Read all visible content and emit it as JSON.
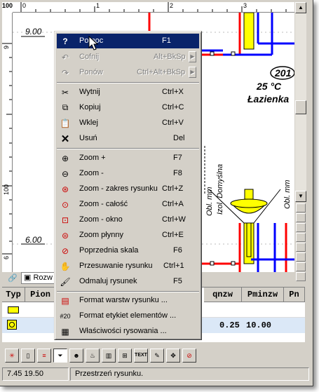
{
  "rulers": {
    "corner": "100",
    "h_ticks": [
      "0",
      "1",
      "2",
      "3"
    ],
    "v_ticks": [
      "9",
      "100",
      "6"
    ]
  },
  "drawing": {
    "level_top": "9.00",
    "level_bottom": "6.00",
    "room_number": "201",
    "room_temp": "25 °C",
    "room_name": "Łazienka",
    "label_izol": "Izol. Domyślna",
    "label_obl_1": "Obl. mm",
    "label_obl_2": "Obl. mm",
    "pipe_red": "#ff0000",
    "pipe_blue": "#0000ff",
    "fixture_yellow": "#ffff00"
  },
  "sheet_tab": {
    "label": "Rozw"
  },
  "table": {
    "headers": [
      "Typ",
      "Pion",
      "qnzw",
      "Pminzw",
      "Pn"
    ],
    "row2": {
      "qnzw": "0.25",
      "pminzw": "10.00"
    },
    "icons": [
      "radiator-type-icon",
      "valve-type-icon"
    ]
  },
  "context_menu": {
    "items": [
      {
        "label": "Pomoc",
        "shortcut": "F1",
        "icon": "help-icon",
        "state": "selected"
      },
      {
        "label": "Cofnij",
        "shortcut": "Alt+BkSp",
        "icon": "undo-icon",
        "state": "disabled",
        "submenu": true
      },
      {
        "label": "Ponów",
        "shortcut": "Ctrl+Alt+BkSp",
        "icon": "redo-icon",
        "state": "disabled",
        "submenu": true
      },
      {
        "label": "Wytnij",
        "shortcut": "Ctrl+X",
        "icon": "cut-icon"
      },
      {
        "label": "Kopiuj",
        "shortcut": "Ctrl+C",
        "icon": "copy-icon"
      },
      {
        "label": "Wklej",
        "shortcut": "Ctrl+V",
        "icon": "paste-icon"
      },
      {
        "label": "Usuń",
        "shortcut": "Del",
        "icon": "delete-icon"
      },
      {
        "label": "Zoom +",
        "shortcut": "F7",
        "icon": "zoom-in-icon"
      },
      {
        "label": "Zoom -",
        "shortcut": "F8",
        "icon": "zoom-out-icon"
      },
      {
        "label": "Zoom - zakres rysunku",
        "shortcut": "Ctrl+Z",
        "icon": "zoom-extent-icon"
      },
      {
        "label": "Zoom - całość",
        "shortcut": "Ctrl+A",
        "icon": "zoom-all-icon"
      },
      {
        "label": "Zoom - okno",
        "shortcut": "Ctrl+W",
        "icon": "zoom-window-icon"
      },
      {
        "label": "Zoom płynny",
        "shortcut": "Ctrl+E",
        "icon": "zoom-smooth-icon"
      },
      {
        "label": "Poprzednia skala",
        "shortcut": "F6",
        "icon": "previous-scale-icon"
      },
      {
        "label": "Przesuwanie rysunku",
        "shortcut": "Ctrl+1",
        "icon": "pan-hand-icon"
      },
      {
        "label": "Odmaluj rysunek",
        "shortcut": "F5",
        "icon": "redraw-brush-icon"
      },
      {
        "label": "Format warstw rysunku ...",
        "shortcut": "",
        "icon": "layers-format-icon"
      },
      {
        "label": "Format etykiet elementów ...",
        "shortcut": "",
        "icon": "labels-format-icon"
      },
      {
        "label": "Właściwości rysowania ...",
        "shortcut": "",
        "icon": "drawing-properties-icon"
      }
    ]
  },
  "toolbar": {
    "buttons": [
      "elements-icon",
      "pipe-vertical-icon",
      "pipes-horizontal-icon",
      "funnel-icon",
      "person-icon",
      "fixture-icon",
      "chart-icon",
      "text-icon",
      "brush-icon",
      "move-icon",
      "no-entry-icon"
    ],
    "text_button": "TEXT"
  },
  "status_bar": {
    "coordinates": "7.45  19.50",
    "message": "Przestrzeń rysunku."
  }
}
